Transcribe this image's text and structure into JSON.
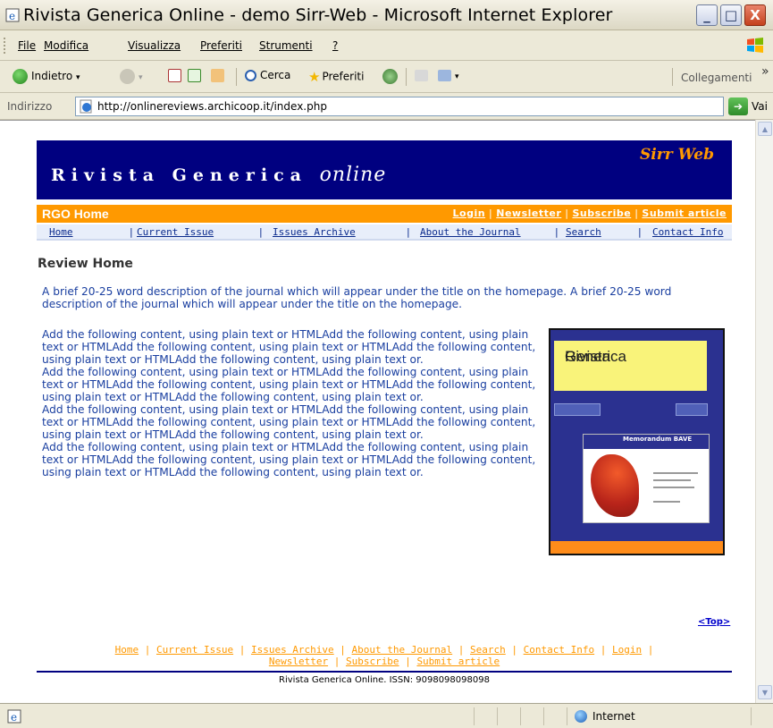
{
  "window": {
    "title": "Rivista Generica Online - demo Sirr-Web - Microsoft Internet Explorer",
    "min_glyph": "_",
    "max_glyph": "□",
    "close_glyph": "X"
  },
  "menubar": {
    "items": [
      "File",
      "Modifica",
      "Visualizza",
      "Preferiti",
      "Strumenti",
      "?"
    ]
  },
  "toolbar": {
    "back_label": "Indietro",
    "search_label": "Cerca",
    "favorites_label": "Preferiti",
    "links_label": "Collegamenti",
    "overflow": "»"
  },
  "addressbar": {
    "label": "Indirizzo",
    "url": "http://onlinereviews.archicoop.it/index.php",
    "go_label": "Vai"
  },
  "statusbar": {
    "zone": "Internet"
  },
  "site": {
    "logo_spaced": "Rivista Generica",
    "logo_em": "online",
    "brand": "Sirr Web",
    "section": "RGO Home",
    "top_links": [
      "Login",
      "Newsletter",
      "Subscribe",
      "Submit article"
    ],
    "nav": [
      "Home",
      "Current Issue",
      "Issues Archive",
      "About the Journal",
      "Search",
      "Contact Info"
    ]
  },
  "main": {
    "title": "Review Home",
    "description": "A brief 20-25 word description of the journal which will appear under the title on the homepage. A brief 20-25 word description of the journal which will appear under the title on the homepage.",
    "paragraphs": [
      "Add the following content, using plain text or HTMLAdd the following content, using plain text or HTMLAdd the following content, using plain text or HTMLAdd the following content, using plain text or HTMLAdd the following content, using plain text or.",
      "Add the following content, using plain text or HTMLAdd the following content, using plain text or HTMLAdd the following content, using plain text or HTMLAdd the following content, using plain text or HTMLAdd the following content, using plain text or.",
      "Add the following content, using plain text or HTMLAdd the following content, using plain text or HTMLAdd the following content, using plain text or HTMLAdd the following content, using plain text or HTMLAdd the following content, using plain text or.",
      "Add the following content, using plain text or HTMLAdd the following content, using plain text or HTMLAdd the following content, using plain text or HTMLAdd the following content, using plain text or HTMLAdd the following content, using plain text or."
    ],
    "cover_title_1": "Rivista",
    "cover_title_2": "Generica",
    "cover_band": "Memorandum BAVE"
  },
  "footer": {
    "top_link": "<Top>",
    "links": [
      "Home",
      "Current Issue",
      "Issues Archive",
      "About the Journal",
      "Search",
      "Contact Info",
      "Login",
      "Newsletter",
      "Subscribe",
      "Submit article"
    ],
    "issn": "Rivista Generica Online. ISSN: 9098098098098"
  }
}
